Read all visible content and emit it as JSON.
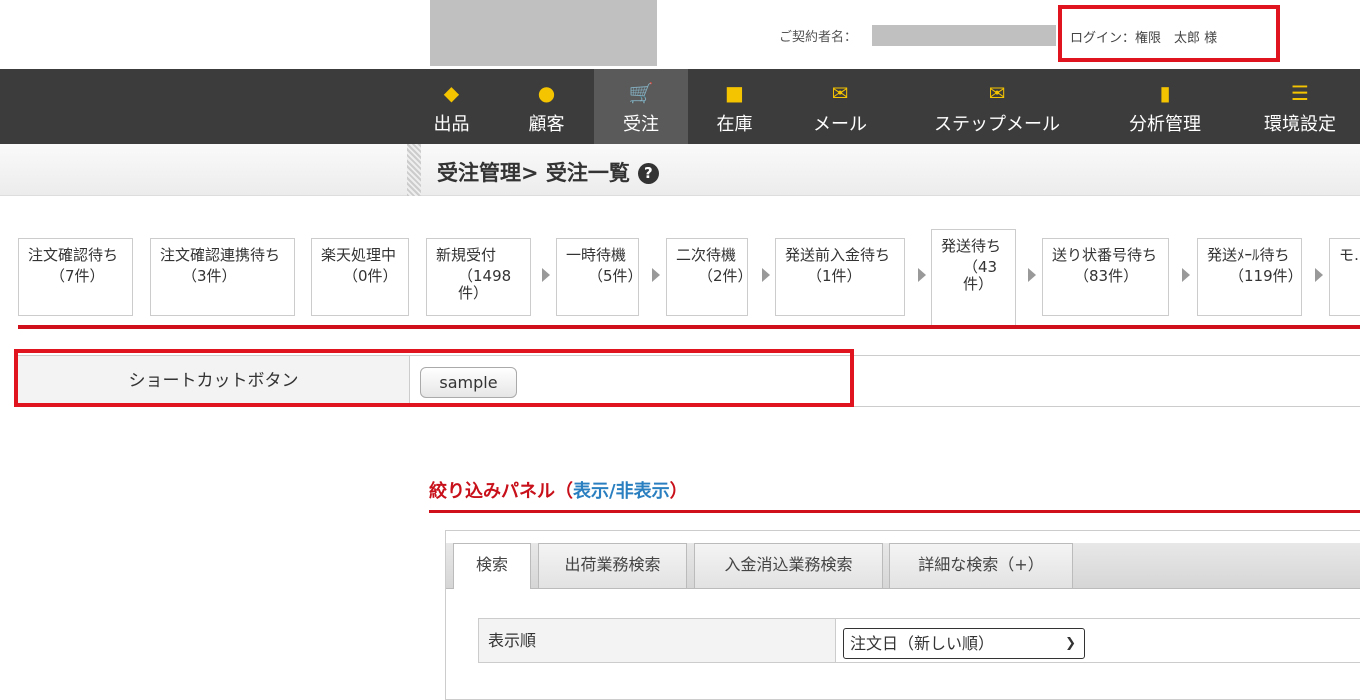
{
  "header": {
    "contract_label": "ご契約者名：",
    "login_text": "ログイン：権限　太郎 様"
  },
  "nav": [
    {
      "label": "出品",
      "icon": "tag-icon",
      "glyph": "◆"
    },
    {
      "label": "顧客",
      "icon": "person-icon",
      "glyph": "●"
    },
    {
      "label": "受注",
      "icon": "cart-icon",
      "glyph": "🛒",
      "active": true
    },
    {
      "label": "在庫",
      "icon": "box-icon",
      "glyph": "■"
    },
    {
      "label": "メール",
      "icon": "mail-icon",
      "glyph": "✉"
    },
    {
      "label": "ステップメール",
      "icon": "step-mail-icon",
      "glyph": "✉"
    },
    {
      "label": "分析管理",
      "icon": "chart-icon",
      "glyph": "▮"
    },
    {
      "label": "環境設定",
      "icon": "sliders-icon",
      "glyph": "☰"
    }
  ],
  "breadcrumb": {
    "title": "受注管理> 受注一覧",
    "help": "?"
  },
  "statuses": [
    {
      "label": "注文確認待ち",
      "count": "（7件）"
    },
    {
      "label": "注文確認連携待ち",
      "count": "（3件）"
    },
    {
      "label": "楽天処理中",
      "count": "（0件）"
    },
    {
      "label": "新規受付",
      "count": "（1498件）"
    },
    {
      "label": "一時待機",
      "count": "（5件）"
    },
    {
      "label": "二次待機",
      "count": "（2件）"
    },
    {
      "label": "発送前入金待ち",
      "count": "（1件）"
    },
    {
      "label": "発送待ち",
      "count": "（43件）"
    },
    {
      "label": "送り状番号待ち",
      "count": "（83件）"
    },
    {
      "label": "発送ﾒｰﾙ待ち",
      "count": "（119件）"
    },
    {
      "label": "モ…ち",
      "count": ""
    }
  ],
  "shortcut": {
    "label": "ショートカットボタン",
    "button": "sample"
  },
  "filter": {
    "title": "絞り込みパネル（",
    "toggle": "表示/非表示",
    "close": "）"
  },
  "tabs": [
    "検索",
    "出荷業務検索",
    "入金消込業務検索",
    "詳細な検索（+）"
  ],
  "search": {
    "sort_label": "表示順",
    "sort_value": "注文日（新しい順）"
  }
}
